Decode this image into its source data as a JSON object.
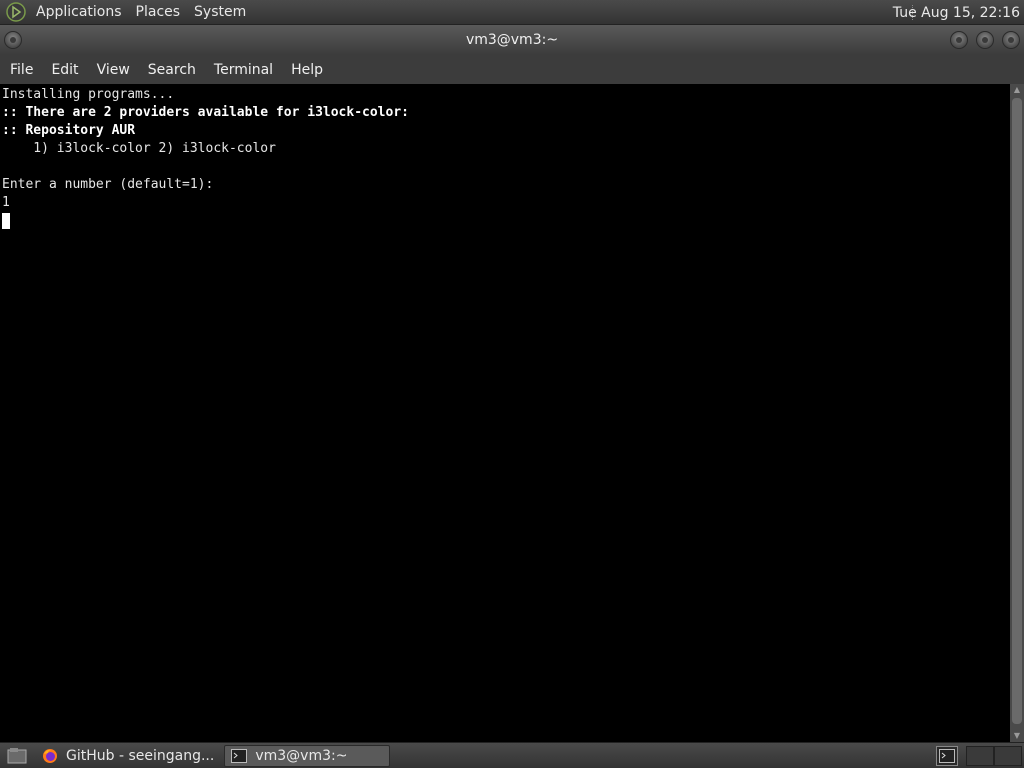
{
  "top_panel": {
    "menus": [
      "Applications",
      "Places",
      "System"
    ],
    "clock": "Tue Aug 15, 22:16"
  },
  "window": {
    "title": "vm3@vm3:~"
  },
  "menubar": {
    "items": [
      "File",
      "Edit",
      "View",
      "Search",
      "Terminal",
      "Help"
    ]
  },
  "terminal": {
    "lines": [
      "Installing programs...",
      ":: There are 2 providers available for i3lock-color:",
      ":: Repository AUR",
      "    1) i3lock-color 2) i3lock-color",
      "",
      "Enter a number (default=1):",
      "1"
    ]
  },
  "taskbar": {
    "tasks": [
      {
        "label": "GitHub - seeingang...",
        "icon": "firefox-icon"
      },
      {
        "label": "vm3@vm3:~",
        "icon": "terminal-icon"
      }
    ]
  },
  "colors": {
    "terminal_bg": "#000000",
    "terminal_fg": "#e6e6e6",
    "panel_bg": "#3c3c3c"
  }
}
